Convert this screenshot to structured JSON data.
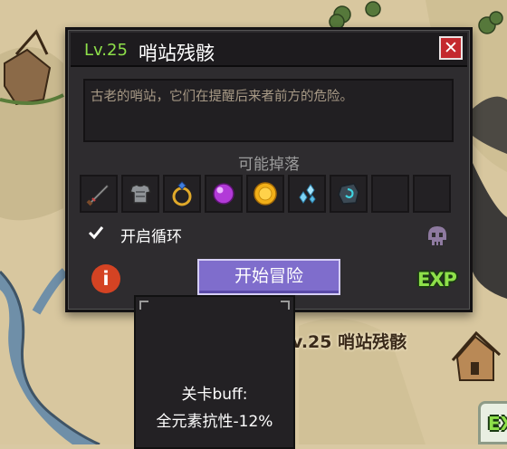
{
  "stage": {
    "level": "Lv.25",
    "name": "哨站残骸",
    "description": "古老的哨站，它们在提醒后来者前方的危险。",
    "drops_title": "可能掉落",
    "drops": [
      {
        "icon": "sword-icon"
      },
      {
        "icon": "chest-armor-icon"
      },
      {
        "icon": "sapphire-ring-icon"
      },
      {
        "icon": "purple-orb-icon"
      },
      {
        "icon": "gold-coin-icon"
      },
      {
        "icon": "crystal-shards-icon"
      },
      {
        "icon": "rune-stone-icon"
      },
      {
        "icon": "empty"
      },
      {
        "icon": "empty"
      }
    ],
    "loop_label": "开启循环",
    "loop_checked": true,
    "start_label": "开始冒险",
    "exp_label": "EXP",
    "close_label": "✕",
    "info_label": "i"
  },
  "map": {
    "stage_label": "v.25 哨站残骸",
    "side_exp_label": "EX"
  },
  "buff": {
    "title": "关卡buff:",
    "value": "全元素抗性-12%"
  },
  "colors": {
    "level_green": "#8ee04a",
    "start_button": "#7f6dcc",
    "close_red": "#c4292e",
    "info_orange": "#d44323"
  }
}
